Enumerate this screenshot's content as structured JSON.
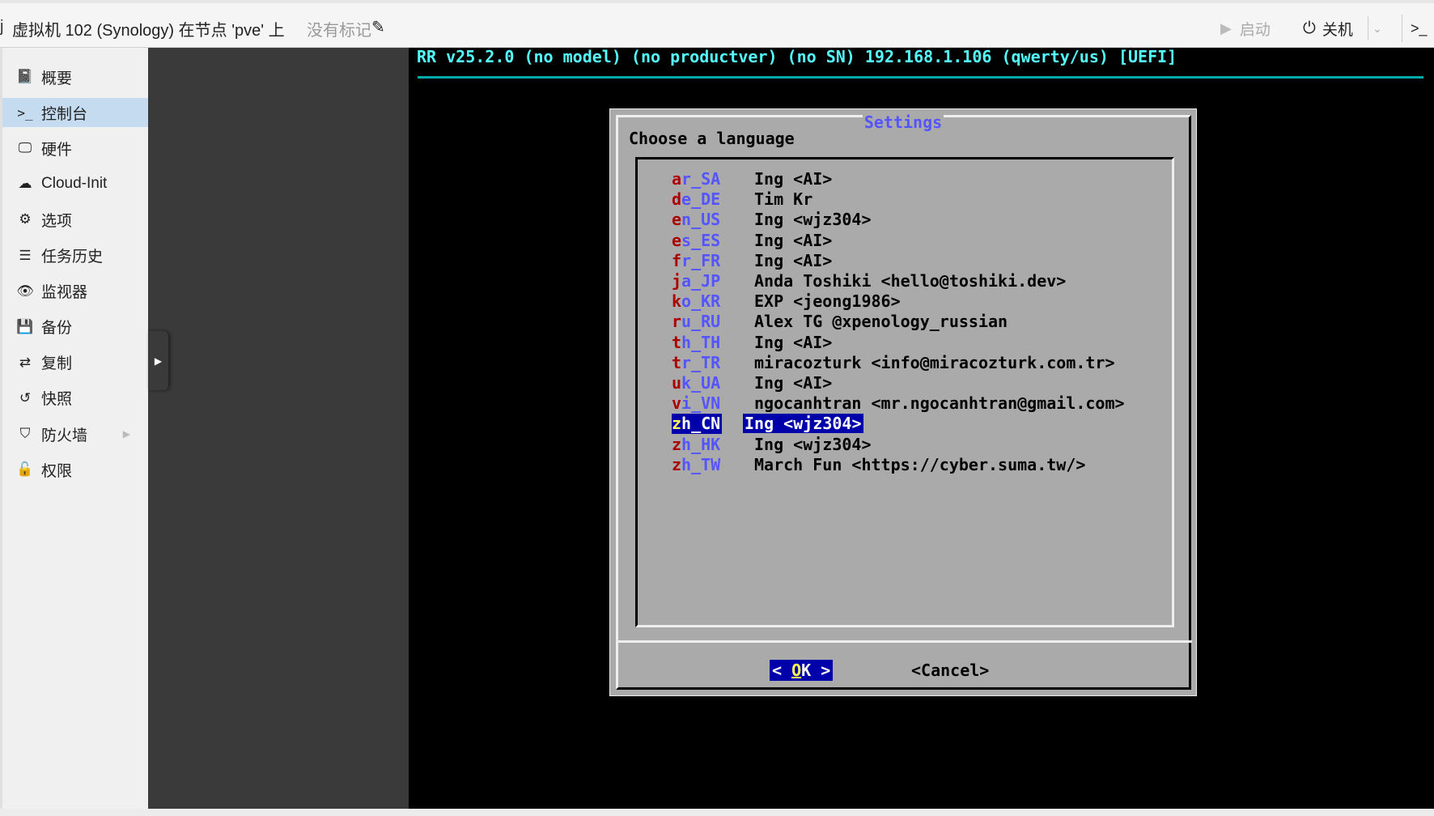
{
  "topbar": {
    "edge_glyph": "j",
    "title": "虚拟机 102 (Synology) 在节点 'pve' 上",
    "no_tag_label": "没有标记",
    "start_label": "启动",
    "shutdown_label": "关机",
    "console_glyph": ">_"
  },
  "sidebar": {
    "items": [
      {
        "label": "概要",
        "icon": "book-icon"
      },
      {
        "label": "控制台",
        "icon": "terminal-icon"
      },
      {
        "label": "硬件",
        "icon": "monitor-icon"
      },
      {
        "label": "Cloud-Init",
        "icon": "cloud-icon"
      },
      {
        "label": "选项",
        "icon": "gear-icon"
      },
      {
        "label": "任务历史",
        "icon": "list-icon"
      },
      {
        "label": "监视器",
        "icon": "eye-icon"
      },
      {
        "label": "备份",
        "icon": "floppy-icon"
      },
      {
        "label": "复制",
        "icon": "retweet-icon"
      },
      {
        "label": "快照",
        "icon": "history-icon"
      },
      {
        "label": "防火墙",
        "icon": "shield-icon"
      },
      {
        "label": "权限",
        "icon": "unlock-icon"
      }
    ],
    "active_index": 1
  },
  "terminal": {
    "header": "RR v25.2.0 (no model) (no productver) (no SN) 192.168.1.106 (qwerty/us) [UEFI]",
    "dialog": {
      "title": "Settings",
      "prompt": "Choose a language",
      "languages": [
        {
          "hot": "a",
          "rest": "r_SA",
          "desc": "Ing <AI>"
        },
        {
          "hot": "d",
          "rest": "e_DE",
          "desc": "Tim Kr"
        },
        {
          "hot": "e",
          "rest": "n_US",
          "desc": "Ing <wjz304>"
        },
        {
          "hot": "e",
          "rest": "s_ES",
          "desc": "Ing <AI>"
        },
        {
          "hot": "f",
          "rest": "r_FR",
          "desc": "Ing <AI>"
        },
        {
          "hot": "j",
          "rest": "a_JP",
          "desc": "Anda Toshiki <hello@toshiki.dev>"
        },
        {
          "hot": "k",
          "rest": "o_KR",
          "desc": "EXP <jeong1986>"
        },
        {
          "hot": "r",
          "rest": "u_RU",
          "desc": "Alex TG @xpenology_russian"
        },
        {
          "hot": "t",
          "rest": "h_TH",
          "desc": "Ing <AI>"
        },
        {
          "hot": "t",
          "rest": "r_TR",
          "desc": "miracozturk <info@miracozturk.com.tr>"
        },
        {
          "hot": "u",
          "rest": "k_UA",
          "desc": "Ing <AI>"
        },
        {
          "hot": "v",
          "rest": "i_VN",
          "desc": "ngocanhtran <mr.ngocanhtran@gmail.com>"
        },
        {
          "hot": "z",
          "rest": "h_CN",
          "desc": "Ing <wjz304>"
        },
        {
          "hot": "z",
          "rest": "h_HK",
          "desc": "Ing <wjz304>"
        },
        {
          "hot": "z",
          "rest": "h_TW",
          "desc": "March Fun <https://cyber.suma.tw/>"
        }
      ],
      "selected_index": 12,
      "ok_left": "< ",
      "ok_hot": "O",
      "ok_rest": "K >",
      "cancel_label": "<Cancel>"
    }
  },
  "colors": {
    "header_cyan": "#54fefe",
    "dialog_grey": "#aaaaaa",
    "hotkey_red": "#aa0000",
    "item_blue": "#5555fe",
    "selection_blue": "#0000aa",
    "selection_yellow": "#fefe54",
    "sidebar_active": "#c5dcf0"
  }
}
